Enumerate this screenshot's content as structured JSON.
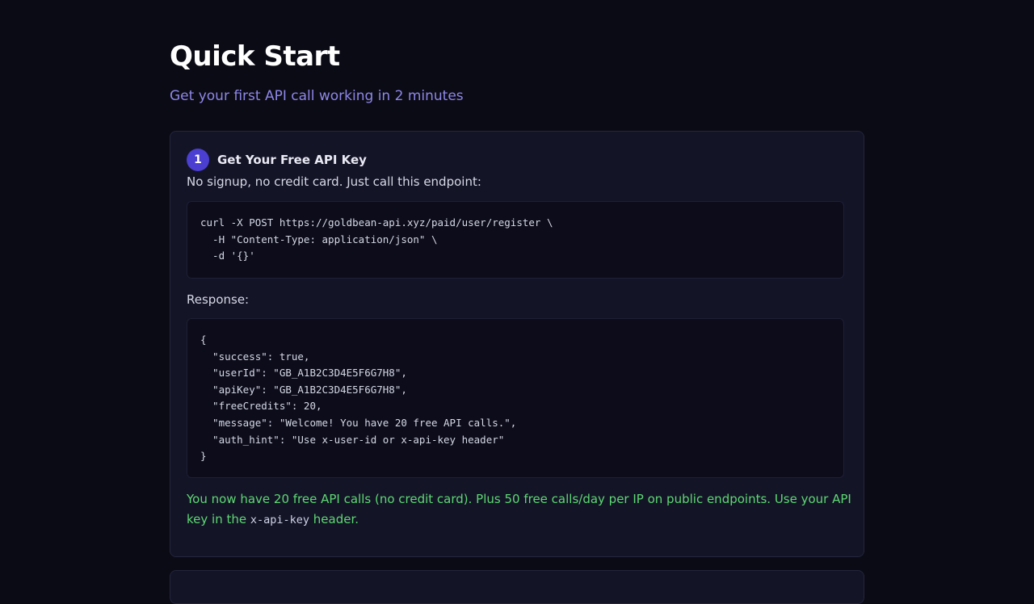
{
  "page": {
    "title": "Quick Start",
    "subtitle": "Get your first API call working in 2 minutes"
  },
  "steps": [
    {
      "number": "1",
      "title": "Get Your Free API Key",
      "description": "No signup, no credit card. Just call this endpoint:",
      "request_code": "curl -X POST https://goldbean-api.xyz/paid/user/register \\\n  -H \"Content-Type: application/json\" \\\n  -d '{}'",
      "response_label": "Response:",
      "response_code": "{\n  \"success\": true,\n  \"userId\": \"GB_A1B2C3D4E5F6G7H8\",\n  \"apiKey\": \"GB_A1B2C3D4E5F6G7H8\",\n  \"freeCredits\": 20,\n  \"message\": \"Welcome! You have 20 free API calls.\",\n  \"auth_hint\": \"Use x-user-id or x-api-key header\"\n}",
      "note_before": "You now have 20 free API calls (no credit card). Plus 50 free calls/day per IP on public endpoints. Use your API key in the ",
      "note_code": "x-api-key",
      "note_after": " header."
    }
  ],
  "colors": {
    "background": "#0b0b15",
    "card": "#141427",
    "accent": "#4a3fd0",
    "subtitle": "#8e87e8",
    "success": "#5dd872"
  }
}
